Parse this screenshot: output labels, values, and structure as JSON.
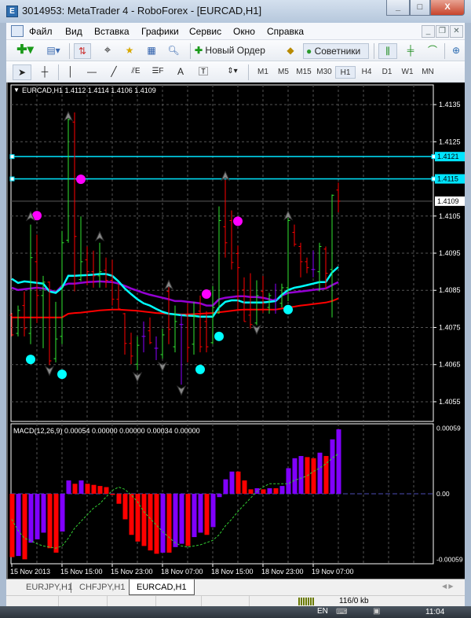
{
  "window": {
    "title": "3014953: MetaTrader 4 - RoboForex - [EURCAD,H1]",
    "app_icon": "metatrader-icon",
    "minimize": "_",
    "maximize": "□",
    "close": "X"
  },
  "menu": {
    "items": [
      "Файл",
      "Вид",
      "Вставка",
      "Графики",
      "Сервис",
      "Окно",
      "Справка"
    ]
  },
  "toolbar1": {
    "new_order": "Новый Ордер",
    "experts": "Советники"
  },
  "toolbar2": {
    "timeframes": [
      "M1",
      "M5",
      "M15",
      "M30",
      "H1",
      "H4",
      "D1",
      "W1",
      "MN"
    ],
    "active_timeframe": "H1",
    "text_tool": "A"
  },
  "chart": {
    "header": "EURCAD,H1  1.4112 1.4114 1.4106 1.4109",
    "colors": {
      "up": "#32e632",
      "down": "#ff0000",
      "doji": "#8a00ff",
      "ma_slow": "#ff0000",
      "ma_mid": "#9400d3",
      "ma_fast": "#00ffff",
      "hline": "#00e5ff",
      "bid": "#5a5a5a"
    },
    "price_ticks": [
      "1.4135",
      "1.4125",
      "1.4105",
      "1.4095",
      "1.4085",
      "1.4075",
      "1.4065",
      "1.4055"
    ],
    "hlines": [
      {
        "price": 1.4121,
        "label": "1.4121"
      },
      {
        "price": 1.4115,
        "label": "1.4115"
      }
    ],
    "bid": {
      "price": 1.4109,
      "label": "1.4109"
    },
    "price_range": [
      1.40497,
      1.41403
    ],
    "date_labels": [
      {
        "bar": 0,
        "text": "15 Nov 2013"
      },
      {
        "bar": 8,
        "text": "15 Nov 15:00"
      },
      {
        "bar": 16,
        "text": "15 Nov 23:00"
      },
      {
        "bar": 24,
        "text": "18 Nov 07:00"
      },
      {
        "bar": 32,
        "text": "18 Nov 15:00"
      },
      {
        "bar": 40,
        "text": "18 Nov 23:00"
      },
      {
        "bar": 48,
        "text": "19 Nov 07:00"
      }
    ],
    "ohlc": [
      [
        1.40783,
        1.40789,
        1.40726,
        1.4073
      ],
      [
        1.40734,
        1.40809,
        1.40726,
        1.40796
      ],
      [
        1.40809,
        1.40847,
        1.40726,
        1.40747
      ],
      [
        1.40734,
        1.41027,
        1.40705,
        1.40938
      ],
      [
        1.40927,
        1.41,
        1.40762,
        1.40836
      ],
      [
        1.40836,
        1.40889,
        1.40694,
        1.40872
      ],
      [
        1.40872,
        1.40874,
        1.40649,
        1.4066
      ],
      [
        1.40666,
        1.40819,
        1.40656,
        1.40719
      ],
      [
        1.40726,
        1.4101,
        1.40705,
        1.40978
      ],
      [
        1.40985,
        1.4132,
        1.40978,
        1.4131
      ],
      [
        1.41303,
        1.41329,
        1.40847,
        1.40995
      ],
      [
        1.40879,
        1.41049,
        1.40874,
        1.40927
      ],
      [
        1.40932,
        1.40968,
        1.40864,
        1.409
      ],
      [
        1.409,
        1.40957,
        1.40857,
        1.40889
      ],
      [
        1.40889,
        1.40978,
        1.40857,
        1.409
      ],
      [
        1.40904,
        1.40938,
        1.40857,
        1.40877
      ],
      [
        1.40877,
        1.40932,
        1.40809,
        1.40826
      ],
      [
        1.40826,
        1.40868,
        1.40798,
        1.408
      ],
      [
        1.40787,
        1.40789,
        1.40677,
        1.40707
      ],
      [
        1.40707,
        1.40736,
        1.40651,
        1.40673
      ],
      [
        1.40651,
        1.40726,
        1.40635,
        1.40702
      ],
      [
        1.40726,
        1.40766,
        1.40683,
        1.40726
      ],
      [
        1.40741,
        1.40777,
        1.40705,
        1.40709
      ],
      [
        1.40694,
        1.40726,
        1.40662,
        1.40694
      ],
      [
        1.40677,
        1.40747,
        1.40666,
        1.4073
      ],
      [
        1.40847,
        1.40868,
        1.40705,
        1.40745
      ],
      [
        1.40698,
        1.40809,
        1.40683,
        1.40766
      ],
      [
        1.40758,
        1.40785,
        1.40596,
        1.40758
      ],
      [
        1.40783,
        1.40815,
        1.40656,
        1.40696
      ],
      [
        1.40705,
        1.40819,
        1.40677,
        1.40779
      ],
      [
        1.40794,
        1.40836,
        1.40683,
        1.40698
      ],
      [
        1.40766,
        1.40794,
        1.40683,
        1.40698
      ],
      [
        1.40709,
        1.40862,
        1.40705,
        1.40804
      ],
      [
        1.40789,
        1.41076,
        1.40787,
        1.41038
      ],
      [
        1.41021,
        1.41148,
        1.40938,
        1.40978
      ],
      [
        1.41038,
        1.41065,
        1.40906,
        1.40925
      ],
      [
        1.40949,
        1.4097,
        1.40794,
        1.40911
      ],
      [
        1.40851,
        1.40885,
        1.40766,
        1.40766
      ],
      [
        1.40783,
        1.40896,
        1.40747,
        1.40758
      ],
      [
        1.40762,
        1.40877,
        1.40756,
        1.40836
      ],
      [
        1.40847,
        1.40889,
        1.40789,
        1.40815
      ],
      [
        1.40804,
        1.40843,
        1.40787,
        1.40836
      ],
      [
        1.40826,
        1.40868,
        1.40787,
        1.40826
      ],
      [
        1.40815,
        1.40868,
        1.40804,
        1.40857
      ],
      [
        1.40857,
        1.41049,
        1.40821,
        1.41038
      ],
      [
        1.41006,
        1.41027,
        1.40968,
        1.40974
      ],
      [
        1.40968,
        1.40978,
        1.40885,
        1.40927
      ],
      [
        1.40927,
        1.40938,
        1.40896,
        1.40911
      ],
      [
        1.40906,
        1.40957,
        1.40885,
        1.40906
      ],
      [
        1.409,
        1.40978,
        1.40847,
        1.40968
      ],
      [
        1.40961,
        1.40968,
        1.40853,
        1.40896
      ],
      [
        1.40906,
        1.41108,
        1.40777,
        1.41106
      ],
      [
        1.4112,
        1.4114,
        1.4106,
        1.4109
      ]
    ],
    "ma_slow": [
      1.40777,
      1.40777,
      1.40777,
      1.40777,
      1.40777,
      1.40777,
      1.40777,
      1.40777,
      1.40777,
      1.40787,
      1.40789,
      1.4079,
      1.40792,
      1.40794,
      1.40796,
      1.40797,
      1.40798,
      1.40798,
      1.40797,
      1.40796,
      1.40795,
      1.40793,
      1.40791,
      1.40789,
      1.40788,
      1.40787,
      1.40786,
      1.40785,
      1.40785,
      1.40786,
      1.40787,
      1.40788,
      1.40789,
      1.40791,
      1.40793,
      1.40795,
      1.40797,
      1.40798,
      1.40798,
      1.40798,
      1.40798,
      1.40798,
      1.40798,
      1.40801,
      1.40804,
      1.40806,
      1.40809,
      1.40811,
      1.40813,
      1.40815,
      1.40817,
      1.40821,
      1.40828
    ],
    "ma_mid": [
      1.40857,
      1.40851,
      1.40853,
      1.40855,
      1.40857,
      1.40855,
      1.40851,
      1.40845,
      1.40862,
      1.40868,
      1.40868,
      1.4087,
      1.40872,
      1.40873,
      1.40874,
      1.40873,
      1.40872,
      1.40868,
      1.40862,
      1.40855,
      1.40849,
      1.40843,
      1.40838,
      1.40834,
      1.4083,
      1.40826,
      1.40821,
      1.40821,
      1.40819,
      1.40817,
      1.40815,
      1.40809,
      1.40809,
      1.40826,
      1.4083,
      1.40832,
      1.40834,
      1.40834,
      1.40832,
      1.40832,
      1.4083,
      1.40826,
      1.40821,
      1.40836,
      1.40843,
      1.40845,
      1.40847,
      1.40849,
      1.40851,
      1.40853,
      1.40855,
      1.40864,
      1.40872
    ],
    "ma_fast": [
      1.40881,
      1.4087,
      1.40874,
      1.40872,
      1.4087,
      1.40868,
      1.40847,
      1.40843,
      1.40857,
      1.40889,
      1.40889,
      1.4089,
      1.40891,
      1.40892,
      1.40894,
      1.40894,
      1.40889,
      1.40874,
      1.40855,
      1.4084,
      1.40826,
      1.40815,
      1.40809,
      1.408,
      1.40792,
      1.40787,
      1.40785,
      1.40783,
      1.40782,
      1.40781,
      1.40779,
      1.40779,
      1.40779,
      1.40804,
      1.40819,
      1.40823,
      1.40823,
      1.40817,
      1.40817,
      1.40817,
      1.40817,
      1.40819,
      1.40821,
      1.40838,
      1.40851,
      1.40857,
      1.4086,
      1.40864,
      1.40868,
      1.40872,
      1.40872,
      1.40898,
      1.40913
    ],
    "dots_magenta": [
      {
        "bar": 4,
        "price": 1.41051
      },
      {
        "bar": 11,
        "price": 1.41149
      },
      {
        "bar": 31,
        "price": 1.4084
      },
      {
        "bar": 36,
        "price": 1.41036
      }
    ],
    "dots_cyan": [
      {
        "bar": 3,
        "price": 1.40664
      },
      {
        "bar": 8,
        "price": 1.40624
      },
      {
        "bar": 30,
        "price": 1.40637
      },
      {
        "bar": 33,
        "price": 1.40726
      },
      {
        "bar": 44,
        "price": 1.40798
      }
    ],
    "arrows_up": [
      {
        "bar": 3,
        "price": 1.41049
      },
      {
        "bar": 9,
        "price": 1.41318
      },
      {
        "bar": 14,
        "price": 1.40995
      },
      {
        "bar": 25,
        "price": 1.40864
      },
      {
        "bar": 34,
        "price": 1.41157
      },
      {
        "bar": 44,
        "price": 1.41051
      }
    ],
    "arrows_down": [
      {
        "bar": 6,
        "price": 1.40634
      },
      {
        "bar": 20,
        "price": 1.40617
      },
      {
        "bar": 24,
        "price": 1.40645
      },
      {
        "bar": 27,
        "price": 1.40581
      },
      {
        "bar": 39,
        "price": 1.40745
      }
    ]
  },
  "macd": {
    "header": "MACD(12,26,9) 0.00054 0.00000 0.00000 0.00034 0.00000",
    "ticks": [
      {
        "value": 59,
        "label": "0.00059"
      },
      {
        "value": 0,
        "label": "0.00"
      },
      {
        "value": -59,
        "label": "-0.00059"
      }
    ],
    "unit": 1e-05,
    "range": [
      -63,
      63
    ],
    "histogram": [
      -57,
      -56,
      -59,
      -44,
      -41,
      -35,
      -49,
      -53,
      -34,
      12,
      9,
      12,
      9,
      8,
      7,
      6,
      -1,
      -9,
      -23,
      -37,
      -43,
      -47,
      -51,
      -54,
      -53,
      -53,
      -48,
      -45,
      -47,
      -39,
      -35,
      -37,
      -30,
      -3,
      13,
      20,
      20,
      12,
      4,
      5,
      4,
      5,
      5,
      7,
      23,
      32,
      34,
      33,
      32,
      37,
      34,
      49,
      58
    ],
    "bar_colors": [
      "R",
      "P",
      "R",
      "P",
      "P",
      "P",
      "R",
      "R",
      "P",
      "P",
      "R",
      "P",
      "R",
      "R",
      "R",
      "R",
      "R",
      "R",
      "R",
      "R",
      "R",
      "R",
      "R",
      "R",
      "P",
      "R",
      "P",
      "P",
      "R",
      "P",
      "P",
      "R",
      "P",
      "P",
      "P",
      "P",
      "R",
      "R",
      "R",
      "P",
      "R",
      "P",
      "R",
      "P",
      "P",
      "P",
      "P",
      "R",
      "R",
      "P",
      "R",
      "P",
      "P"
    ],
    "signal": [
      -23,
      -33,
      -40,
      -42,
      -45,
      -47,
      -48,
      -49,
      -47,
      -40,
      -31,
      -25,
      -19,
      -13,
      -9,
      -3,
      3,
      6,
      4,
      -1,
      -7,
      -16,
      -22,
      -28,
      -34,
      -39,
      -44,
      -47,
      -48,
      -47,
      -46,
      -44,
      -42,
      -37,
      -29,
      -23,
      -16,
      -10,
      -4,
      2,
      6,
      9,
      9,
      9,
      9,
      12,
      14,
      16,
      20,
      23,
      27,
      32,
      36
    ],
    "colors": {
      "R": "#ff0000",
      "P": "#8000ff",
      "signal": "#32cd32",
      "zero": "#4b4bb4"
    }
  },
  "tabs": [
    {
      "label": "EURJPY,H1"
    },
    {
      "label": "CHFJPY,H1"
    },
    {
      "label": "EURCAD,H1",
      "active": true
    }
  ],
  "status": {
    "traffic": "116/0 kb"
  },
  "taskbar": {
    "lang": "EN",
    "time": "11:04"
  }
}
